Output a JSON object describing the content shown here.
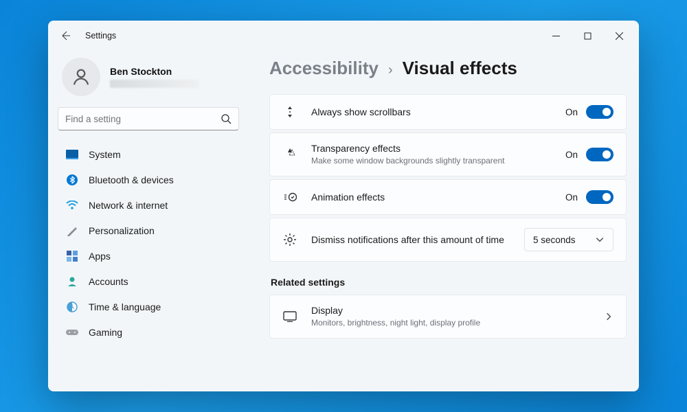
{
  "window": {
    "title": "Settings"
  },
  "user": {
    "name": "Ben Stockton"
  },
  "search": {
    "placeholder": "Find a setting"
  },
  "nav": [
    {
      "label": "System"
    },
    {
      "label": "Bluetooth & devices"
    },
    {
      "label": "Network & internet"
    },
    {
      "label": "Personalization"
    },
    {
      "label": "Apps"
    },
    {
      "label": "Accounts"
    },
    {
      "label": "Time & language"
    },
    {
      "label": "Gaming"
    }
  ],
  "breadcrumb": {
    "parent": "Accessibility",
    "current": "Visual effects"
  },
  "settings": {
    "scrollbars": {
      "title": "Always show scrollbars",
      "state": "On"
    },
    "transparency": {
      "title": "Transparency effects",
      "desc": "Make some window backgrounds slightly transparent",
      "state": "On"
    },
    "animation": {
      "title": "Animation effects",
      "state": "On"
    },
    "dismiss": {
      "title": "Dismiss notifications after this amount of time",
      "value": "5 seconds"
    }
  },
  "related": {
    "heading": "Related settings",
    "display": {
      "title": "Display",
      "desc": "Monitors, brightness, night light, display profile"
    }
  }
}
